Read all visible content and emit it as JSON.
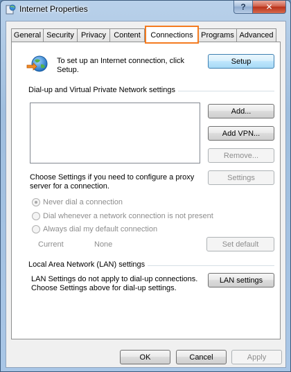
{
  "window": {
    "title": "Internet Properties",
    "help_glyph": "?",
    "close_glyph": "✕"
  },
  "tabs": [
    {
      "label": "General",
      "active": false
    },
    {
      "label": "Security",
      "active": false
    },
    {
      "label": "Privacy",
      "active": false
    },
    {
      "label": "Content",
      "active": false
    },
    {
      "label": "Connections",
      "active": true
    },
    {
      "label": "Programs",
      "active": false
    },
    {
      "label": "Advanced",
      "active": false
    }
  ],
  "setup": {
    "text_line1": "To set up an Internet connection, click",
    "text_line2": "Setup.",
    "button": "Setup"
  },
  "dialup": {
    "heading": "Dial-up and Virtual Private Network settings",
    "add_button": "Add...",
    "add_vpn_button": "Add VPN...",
    "remove_button": "Remove...",
    "proxy_text_line1": "Choose Settings if you need to configure a proxy",
    "proxy_text_line2": "server for a connection.",
    "settings_button": "Settings",
    "radio_never": "Never dial a connection",
    "radio_whenever": "Dial whenever a network connection is not present",
    "radio_always": "Always dial my default connection",
    "current_label": "Current",
    "current_value": "None",
    "set_default_button": "Set default"
  },
  "lan": {
    "heading": "Local Area Network (LAN) settings",
    "text_line1": "LAN Settings do not apply to dial-up connections.",
    "text_line2": "Choose Settings above for dial-up settings.",
    "button": "LAN settings"
  },
  "footer": {
    "ok": "OK",
    "cancel": "Cancel",
    "apply": "Apply"
  },
  "colors": {
    "highlight": "#f47b20",
    "disabled_text": "#8d8d8d"
  }
}
